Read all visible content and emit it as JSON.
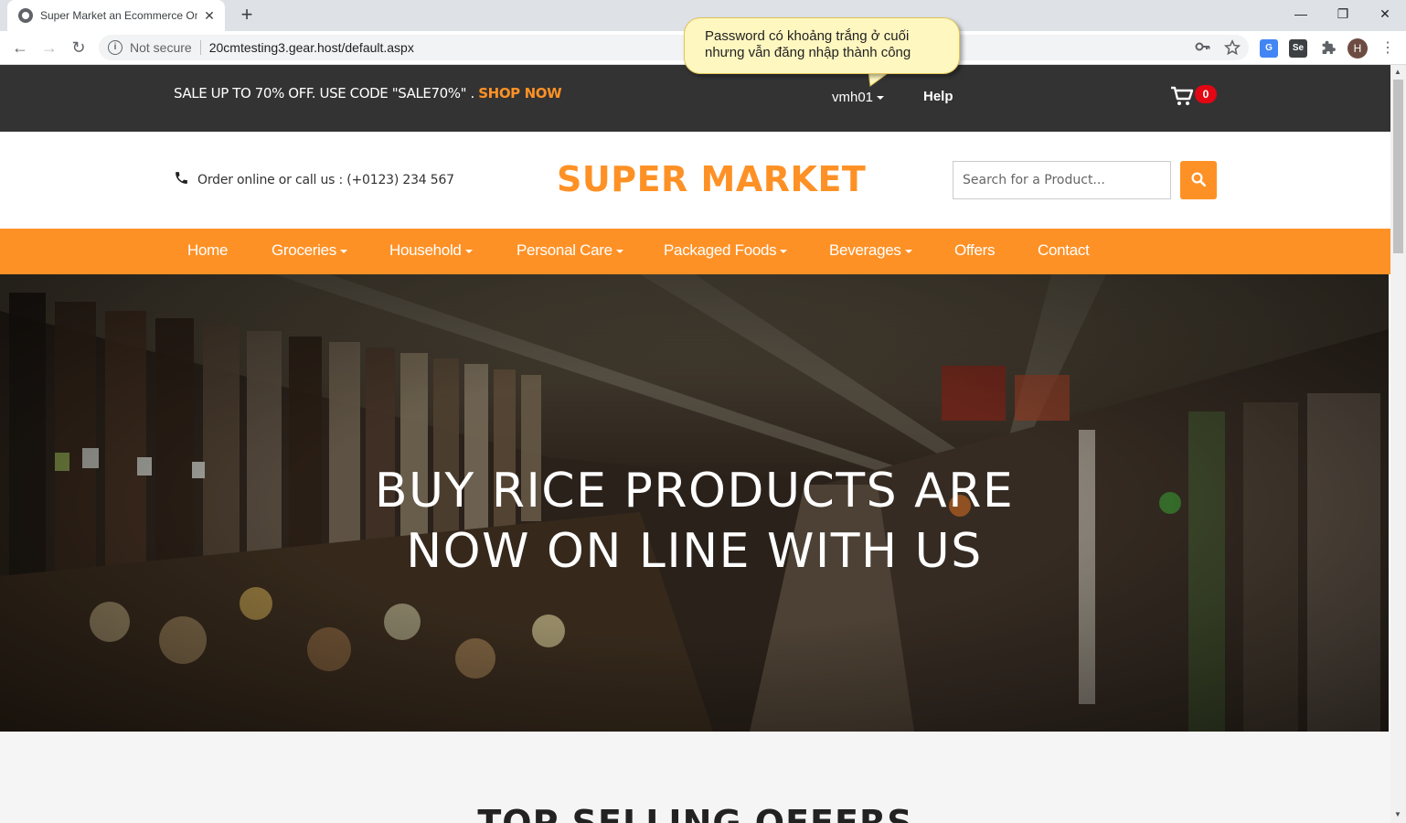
{
  "browser": {
    "tab_title": "Super Market an Ecommerce Online",
    "tab_close": "✕",
    "new_tab": "+",
    "security_label": "Not secure",
    "url": "20cmtesting3.gear.host/default.aspx",
    "profile_initial": "H",
    "window_controls": {
      "minimize": "—",
      "restore": "❐",
      "close": "✕"
    }
  },
  "annotation": {
    "line1": "Password có khoảng trắng ở cuối",
    "line2": "nhưng vẫn đăng nhập thành công"
  },
  "topbar": {
    "promo_text": "SALE UP TO 70% OFF. USE CODE \"SALE70%\" . ",
    "promo_link": "SHOP NOW",
    "username": "vmh01",
    "help": "Help",
    "cart_count": "0"
  },
  "header": {
    "call_text": "Order online or call us : (+0123) 234 567",
    "logo": "SUPER MARKET",
    "search_placeholder": "Search for a Product..."
  },
  "nav": {
    "items": [
      {
        "label": "Home",
        "dropdown": false
      },
      {
        "label": "Groceries",
        "dropdown": true
      },
      {
        "label": "Household",
        "dropdown": true
      },
      {
        "label": "Personal Care",
        "dropdown": true
      },
      {
        "label": "Packaged Foods",
        "dropdown": true
      },
      {
        "label": "Beverages",
        "dropdown": true
      },
      {
        "label": "Offers",
        "dropdown": false
      },
      {
        "label": "Contact",
        "dropdown": false
      }
    ]
  },
  "hero": {
    "line1": "BUY RICE PRODUCTS ARE",
    "line2": "NOW ON LINE WITH US"
  },
  "section": {
    "title": "TOP SELLING OFFERS"
  },
  "colors": {
    "accent": "#fe9126",
    "topbar_bg": "#333333",
    "badge": "#e30613"
  }
}
